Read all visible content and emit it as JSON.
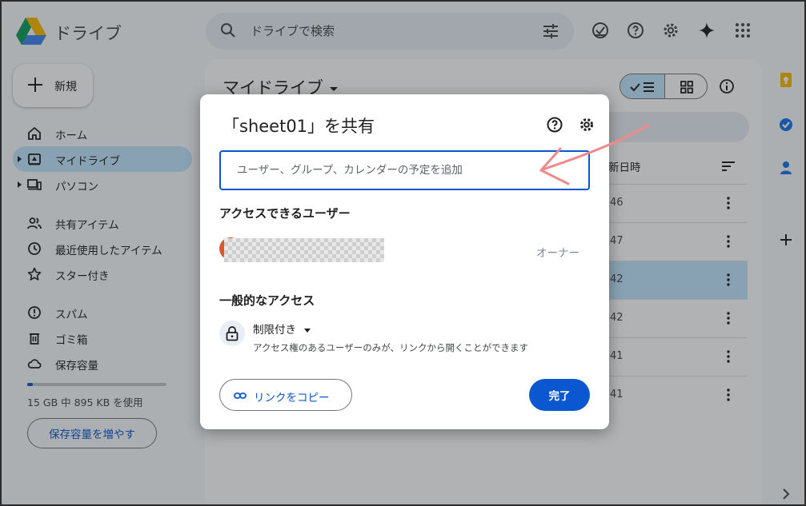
{
  "header": {
    "app_name": "ドライブ",
    "search_placeholder": "ドライブで検索",
    "icons": [
      "search-icon",
      "tune-icon",
      "offline-ready-icon",
      "help-icon",
      "settings-icon",
      "gemini-icon",
      "apps-grid-icon"
    ]
  },
  "sidebar": {
    "new_label": "新規",
    "groups": [
      [
        {
          "label": "ホーム",
          "icon": "home-icon",
          "active": false,
          "expandable": false
        },
        {
          "label": "マイドライブ",
          "icon": "my-drive-icon",
          "active": true,
          "expandable": true
        },
        {
          "label": "パソコン",
          "icon": "computer-icon",
          "active": false,
          "expandable": true
        }
      ],
      [
        {
          "label": "共有アイテム",
          "icon": "people-icon",
          "active": false,
          "expandable": false
        },
        {
          "label": "最近使用したアイテム",
          "icon": "clock-icon",
          "active": false,
          "expandable": false
        },
        {
          "label": "スター付き",
          "icon": "star-icon",
          "active": false,
          "expandable": false
        }
      ],
      [
        {
          "label": "スパム",
          "icon": "spam-icon",
          "active": false,
          "expandable": false
        },
        {
          "label": "ゴミ箱",
          "icon": "trash-icon",
          "active": false,
          "expandable": false
        },
        {
          "label": "保存容量",
          "icon": "cloud-icon",
          "active": false,
          "expandable": false
        }
      ]
    ],
    "storage_text": "15 GB 中 895 KB を使用",
    "storage_button": "保存容量を増やす"
  },
  "main": {
    "title": "マイドライブ",
    "column_header": "新日時",
    "rows": [
      {
        "time": "46",
        "selected": false
      },
      {
        "time": "47",
        "selected": false
      },
      {
        "time": "42",
        "selected": true
      },
      {
        "time": "42",
        "selected": false
      },
      {
        "time": "41",
        "selected": false
      },
      {
        "time": "41",
        "selected": false
      }
    ]
  },
  "side_panel": {
    "icons": [
      "keep-icon",
      "tasks-icon",
      "contacts-icon",
      "add-icon",
      "chevron-right-icon"
    ]
  },
  "dialog": {
    "title": "「sheet01」を共有",
    "input_placeholder": "ユーザー、グループ、カレンダーの予定を追加",
    "users_section_title": "アクセスできるユーザー",
    "owner_role": "オーナー",
    "general_access_title": "一般的なアクセス",
    "access_level": "制限付き",
    "access_description": "アクセス権のあるユーザーのみが、リンクから開くことができます",
    "copy_link_label": "リンクをコピー",
    "done_label": "完了"
  },
  "colors": {
    "accent": "#0b57d0",
    "selected_bg": "#c2e7ff",
    "annotation_arrow": "#f08a8a"
  }
}
